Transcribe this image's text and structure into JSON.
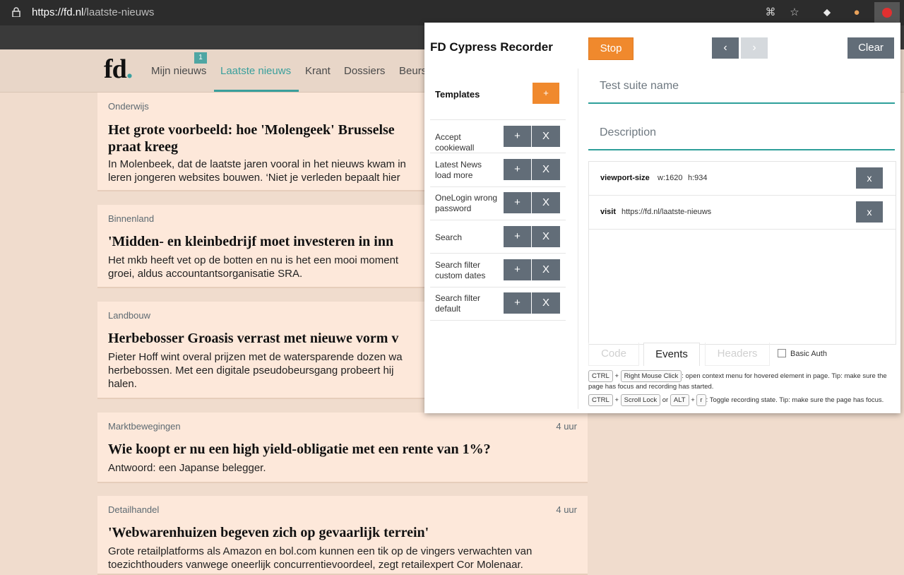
{
  "browser": {
    "url_host": "https://fd.nl",
    "url_path": "/laatste-nieuws",
    "icons": [
      "lock-icon",
      "translate-icon",
      "star-icon",
      "tag-icon",
      "extension-icon",
      "recorder-icon"
    ]
  },
  "site": {
    "logo_main": "fd",
    "logo_dot": ".",
    "nav": [
      "Mijn nieuws",
      "Laatste nieuws",
      "Krant",
      "Dossiers",
      "Beurs"
    ],
    "badge": "1",
    "articles": [
      {
        "cat": "Onderwijs",
        "time": "",
        "title1": "Het grote voorbeeld: hoe 'Molengeek' Brusselse",
        "title2": "praat kreeg",
        "body1": "In Molenbeek, dat de laatste jaren vooral in het nieuws kwam in",
        "body2": "leren jongeren websites bouwen. ‘Niet je verleden bepaalt hier"
      },
      {
        "cat": "Binnenland",
        "time": "",
        "title1": "'Midden- en kleinbedrijf moet investeren in inn",
        "body1": "Het mkb heeft vet op de botten en nu is het een mooi moment",
        "body2": "groei, aldus accountantsorganisatie SRA."
      },
      {
        "cat": "Landbouw",
        "time": "",
        "title1": "Herbebosser Groasis verrast met nieuwe vorm v",
        "body1": "Pieter Hoff wint overal prijzen met de watersparende dozen wa",
        "body2": "herbebossen. Met een digitale pseudobeursgang probeert hij",
        "body3": "halen."
      },
      {
        "cat": "Marktbewegingen",
        "time": "4 uur",
        "title1": "Wie koopt er nu een high yield-obligatie met een rente van 1%?",
        "body1": "Antwoord: een Japanse belegger."
      },
      {
        "cat": "Detailhandel",
        "time": "4 uur",
        "title1": "'Webwarenhuizen begeven zich op gevaarlijk terrein'",
        "body1": "Grote retailplatforms als Amazon en bol.com kunnen een tik op de vingers verwachten van",
        "body2": "toezichthouders vanwege oneerlijk concurrentievoordeel, zegt retailexpert Cor Molenaar."
      }
    ]
  },
  "recorder": {
    "title": "FD Cypress Recorder",
    "stop": "Stop",
    "prev": "‹",
    "next": "›",
    "clear": "Clear",
    "templates_heading": "Templates",
    "add": "+",
    "templates": [
      "Accept cookiewall",
      "Latest News load more",
      "OneLogin wrong password",
      "Search",
      "Search filter custom dates",
      "Search filter default"
    ],
    "plus": "+",
    "x": "X",
    "suite_placeholder": "Test suite name",
    "description_placeholder": "Description",
    "events": [
      {
        "name": "viewport-size",
        "val1": "w:1620",
        "val2": "h:934"
      },
      {
        "name": "visit",
        "val1": "https://fd.nl/laatste-nieuws",
        "val2": ""
      }
    ],
    "event_remove": "x",
    "tabs": [
      "Code",
      "Events",
      "Headers"
    ],
    "basic_auth": "Basic Auth",
    "help": {
      "ctrl": "CTRL",
      "plus": "+",
      "right_click": "Right Mouse Click",
      "line1_text": ": open context menu for hovered element in page. Tip: make sure the",
      "line1_cont": "page has focus and recording has started.",
      "scroll_lock": "Scroll Lock",
      "or": "or",
      "alt": "ALT",
      "r": "r",
      "line2_text": ": Toggle recording state. Tip: make sure the page has focus."
    }
  }
}
